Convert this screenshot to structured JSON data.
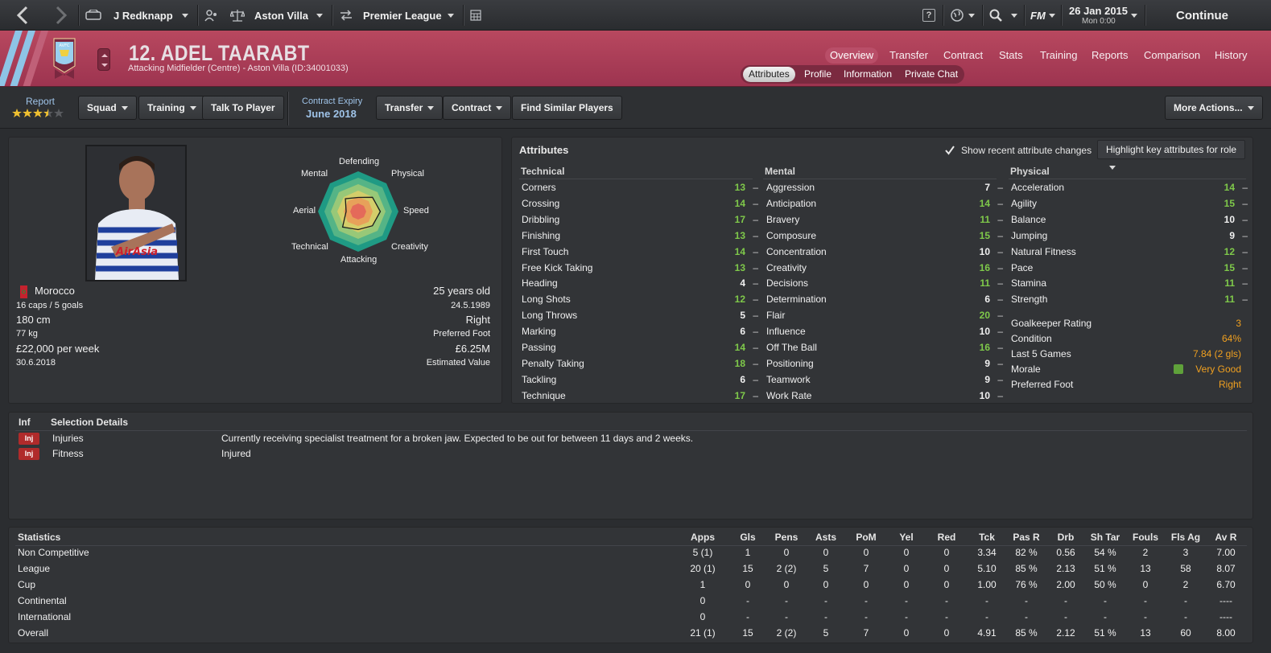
{
  "topbar": {
    "manager": "J Redknapp",
    "club": "Aston Villa",
    "competition": "Premier League",
    "date": "26 Jan 2015",
    "time": "Mon 0:00",
    "continue_label": "Continue",
    "fm_label": "FM",
    "help_label": "?"
  },
  "player": {
    "name": "12. ADEL TAARABT",
    "subtitle": "Attacking Midfielder (Centre) - Aston Villa (ID:34001033)",
    "club_crest_text": "AVFC"
  },
  "nav_tabs": [
    "Overview",
    "Transfer",
    "Contract",
    "Stats",
    "Training",
    "Reports",
    "Comparison",
    "History"
  ],
  "sub_tabs": [
    "Attributes",
    "Profile",
    "Information",
    "Private Chat"
  ],
  "toolbar": {
    "report_label": "Report",
    "report_stars": 3.5,
    "squad": "Squad",
    "training": "Training",
    "talk": "Talk To Player",
    "contract_expiry_label": "Contract Expiry",
    "contract_expiry_value": "June 2018",
    "transfer": "Transfer",
    "contract": "Contract",
    "find_similar": "Find Similar Players",
    "more_actions": "More Actions..."
  },
  "profile": {
    "nationality": "Morocco",
    "caps": "16 caps / 5 goals",
    "height": "180 cm",
    "weight": "77 kg",
    "wage": "£22,000 per week",
    "contract_end": "30.6.2018",
    "age": "25 years old",
    "dob": "24.5.1989",
    "foot": "Right",
    "foot_label": "Preferred Foot",
    "value": "£6.25M",
    "value_label": "Estimated Value",
    "radar_labels": [
      "Defending",
      "Physical",
      "Speed",
      "Creativity",
      "Attacking",
      "Technical",
      "Aerial",
      "Mental"
    ],
    "radar_values": [
      0.35,
      0.5,
      0.55,
      0.5,
      0.45,
      0.55,
      0.3,
      0.45
    ]
  },
  "attributes": {
    "title": "Attributes",
    "show_changes": "Show recent attribute changes",
    "highlight": "Highlight key attributes for role",
    "technical_title": "Technical",
    "mental_title": "Mental",
    "physical_title": "Physical",
    "technical": [
      {
        "name": "Corners",
        "value": "13"
      },
      {
        "name": "Crossing",
        "value": "14"
      },
      {
        "name": "Dribbling",
        "value": "17"
      },
      {
        "name": "Finishing",
        "value": "13"
      },
      {
        "name": "First Touch",
        "value": "14"
      },
      {
        "name": "Free Kick Taking",
        "value": "13"
      },
      {
        "name": "Heading",
        "value": "4"
      },
      {
        "name": "Long Shots",
        "value": "12"
      },
      {
        "name": "Long Throws",
        "value": "5"
      },
      {
        "name": "Marking",
        "value": "6"
      },
      {
        "name": "Passing",
        "value": "14"
      },
      {
        "name": "Penalty Taking",
        "value": "18"
      },
      {
        "name": "Tackling",
        "value": "6"
      },
      {
        "name": "Technique",
        "value": "17"
      }
    ],
    "mental": [
      {
        "name": "Aggression",
        "value": "7"
      },
      {
        "name": "Anticipation",
        "value": "14"
      },
      {
        "name": "Bravery",
        "value": "11"
      },
      {
        "name": "Composure",
        "value": "15"
      },
      {
        "name": "Concentration",
        "value": "10"
      },
      {
        "name": "Creativity",
        "value": "16"
      },
      {
        "name": "Decisions",
        "value": "11"
      },
      {
        "name": "Determination",
        "value": "6"
      },
      {
        "name": "Flair",
        "value": "20"
      },
      {
        "name": "Influence",
        "value": "10"
      },
      {
        "name": "Off The Ball",
        "value": "16"
      },
      {
        "name": "Positioning",
        "value": "9"
      },
      {
        "name": "Teamwork",
        "value": "9"
      },
      {
        "name": "Work Rate",
        "value": "10"
      }
    ],
    "physical": [
      {
        "name": "Acceleration",
        "value": "14"
      },
      {
        "name": "Agility",
        "value": "15"
      },
      {
        "name": "Balance",
        "value": "10"
      },
      {
        "name": "Jumping",
        "value": "9"
      },
      {
        "name": "Natural Fitness",
        "value": "12"
      },
      {
        "name": "Pace",
        "value": "15"
      },
      {
        "name": "Stamina",
        "value": "11"
      },
      {
        "name": "Strength",
        "value": "11"
      }
    ],
    "extra": [
      {
        "name": "Goalkeeper Rating",
        "value": "3"
      },
      {
        "name": "Condition",
        "value": "64%"
      },
      {
        "name": "Last 5 Games",
        "value": "7.84 (2 gls)"
      },
      {
        "name": "Morale",
        "value": "Very Good"
      },
      {
        "name": "Preferred Foot",
        "value": "Right"
      }
    ],
    "dash": "–"
  },
  "selection": {
    "col_inf": "Inf",
    "col_details": "Selection Details",
    "rows": [
      {
        "badge": "Inj",
        "label": "Injuries",
        "detail": "Currently receiving specialist treatment for a broken jaw. Expected to be out for between 11 days and 2 weeks."
      },
      {
        "badge": "Inj",
        "label": "Fitness",
        "detail": "Injured"
      }
    ]
  },
  "statistics": {
    "title": "Statistics",
    "columns": [
      "Apps",
      "Gls",
      "Pens",
      "Asts",
      "PoM",
      "Yel",
      "Red",
      "Tck",
      "Pas R",
      "Drb",
      "Sh Tar",
      "Fouls",
      "Fls Ag",
      "Av R"
    ],
    "rows": [
      {
        "label": "Non Competitive",
        "cells": [
          "5 (1)",
          "1",
          "0",
          "0",
          "0",
          "0",
          "0",
          "3.34",
          "82 %",
          "0.56",
          "54 %",
          "2",
          "3",
          "7.00"
        ]
      },
      {
        "label": "League",
        "cells": [
          "20 (1)",
          "15",
          "2 (2)",
          "5",
          "7",
          "0",
          "0",
          "5.10",
          "85 %",
          "2.13",
          "51 %",
          "13",
          "58",
          "8.07"
        ]
      },
      {
        "label": "Cup",
        "cells": [
          "1",
          "0",
          "0",
          "0",
          "0",
          "0",
          "0",
          "1.00",
          "76 %",
          "2.00",
          "50 %",
          "0",
          "2",
          "6.70"
        ]
      },
      {
        "label": "Continental",
        "cells": [
          "0",
          "-",
          "-",
          "-",
          "-",
          "-",
          "-",
          "-",
          "-",
          "-",
          "-",
          "-",
          "-",
          "----"
        ]
      },
      {
        "label": "International",
        "cells": [
          "0",
          "-",
          "-",
          "-",
          "-",
          "-",
          "-",
          "-",
          "-",
          "-",
          "-",
          "-",
          "-",
          "----"
        ]
      },
      {
        "label": "Overall",
        "cells": [
          "21 (1)",
          "15",
          "2 (2)",
          "5",
          "7",
          "0",
          "0",
          "4.91",
          "85 %",
          "2.12",
          "51 %",
          "13",
          "60",
          "8.00"
        ]
      }
    ]
  }
}
